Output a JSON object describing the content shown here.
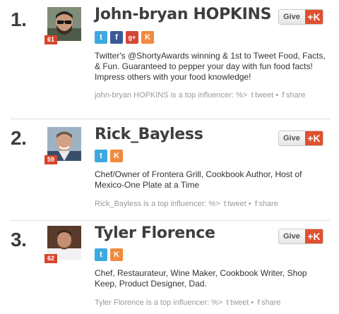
{
  "leaders": [
    {
      "rank": "1.",
      "name": "John-bryan HOPKINS",
      "score": "61",
      "give_label": "Give",
      "plus_k": "+K",
      "socials": [
        "twitter",
        "facebook",
        "google-plus",
        "klout"
      ],
      "bio": "Twitter's @ShortyAwards winning & 1st to Tweet Food, Facts, & Fun. Guaranteed to pepper your day with fun food facts! Impress others with your food knowledge!",
      "influence_text": "john-bryan HOPKINS is a top influencer: %>",
      "tweet_label": "tweet",
      "separator": "•",
      "share_label": "share"
    },
    {
      "rank": "2.",
      "name": "Rick_Bayless",
      "score": "59",
      "give_label": "Give",
      "plus_k": "+K",
      "socials": [
        "twitter",
        "klout"
      ],
      "bio": "Chef/Owner of Frontera Grill, Cookbook Author, Host of Mexico-One Plate at a Time",
      "influence_text": "Rick_Bayless is a top influencer: %>",
      "tweet_label": "tweet",
      "separator": "•",
      "share_label": "share"
    },
    {
      "rank": "3.",
      "name": "Tyler Florence",
      "score": "62",
      "give_label": "Give",
      "plus_k": "+K",
      "socials": [
        "twitter",
        "klout"
      ],
      "bio": "Chef, Restaurateur, Wine Maker, Cookbook Writer, Shop Keep, Product Designer, Dad.",
      "influence_text": "Tyler Florence is a top influencer: %>",
      "tweet_label": "tweet",
      "separator": "•",
      "share_label": "share"
    }
  ],
  "colors": {
    "klout_orange": "#e0502e",
    "score_badge": "#d5462b",
    "twitter": "#3da9e0",
    "facebook": "#3b5b98",
    "google_plus": "#d34836"
  },
  "icons": {
    "twitter": "twitter-icon",
    "facebook": "facebook-icon",
    "google-plus": "google-plus-icon",
    "klout": "klout-icon"
  }
}
